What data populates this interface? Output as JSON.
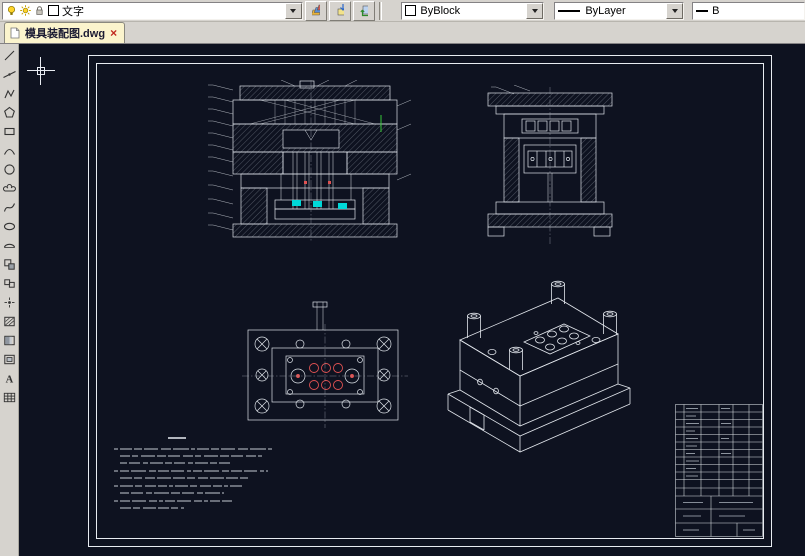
{
  "toolbar": {
    "layer_control": {
      "current_layer": "文字"
    },
    "color_control": {
      "value": "ByBlock"
    },
    "linetype_control": {
      "value": "ByLayer"
    },
    "lineweight_control": {
      "value": "B"
    }
  },
  "tabbar": {
    "tabs": [
      {
        "label": "模具装配图.dwg",
        "close_glyph": "×"
      }
    ]
  },
  "left_toolbar": {
    "mtext_glyph": "A",
    "tools": [
      "line",
      "construction-line",
      "polyline",
      "polygon",
      "rectangle",
      "arc",
      "circle",
      "revision-cloud",
      "spline",
      "ellipse",
      "ellipse-arc",
      "insert-block",
      "make-block",
      "point",
      "hatch",
      "gradient",
      "region",
      "multiline-text",
      "table"
    ]
  },
  "canvas": {
    "background_color": "#0e1220",
    "line_color": "#dde2e8",
    "accent_cyan": "#00d8d8",
    "accent_red": "#e05252",
    "accent_green": "#37c837",
    "views": [
      "front-section-view",
      "side-view",
      "plan-view",
      "isometric-view",
      "title-block",
      "technical-notes"
    ]
  }
}
